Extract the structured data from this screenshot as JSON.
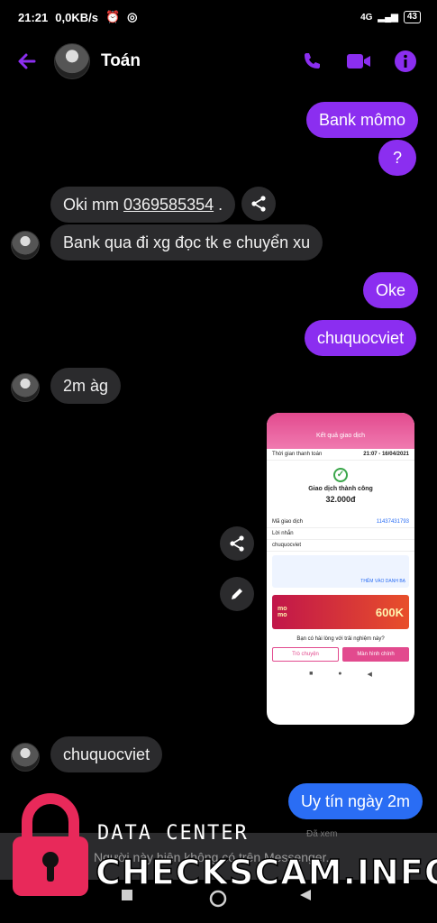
{
  "status_bar": {
    "time": "21:21",
    "speed": "0,0KB/s",
    "signal": "4G",
    "battery": "43"
  },
  "header": {
    "contact_name": "Toán"
  },
  "messages": {
    "m1": "Bank mômo",
    "m2": "?",
    "m3_prefix": "Oki mm ",
    "m3_phone": "0369585354",
    "m3_suffix": " .",
    "m4": "Bank qua đi xg đọc tk e chuyển xu",
    "m5": "Oke",
    "m6": "chuquocviet",
    "m7": "2m àg",
    "m8": "chuquocviet",
    "m9": "Uy tín ngày 2m"
  },
  "receipt": {
    "header": "Kết quả giao dịch",
    "time_label": "Thời gian thanh toán",
    "time_value": "21:07 - 16/04/2021",
    "status": "Giao dịch thành công",
    "amount": "32.000đ",
    "txn_label": "Mã giao dịch",
    "txn_value": "11437431793",
    "note_label": "Lời nhắn",
    "note_value": "chuquocviet",
    "info_link": "THÊM VÀO DANH BẠ",
    "banner": "600K",
    "question": "Bạn có hài lòng với trải nghiệm này?",
    "btn_left": "Trò chuyện",
    "btn_right": "Màn hình chính"
  },
  "footer": {
    "notice": "Người này hiện không có trên Messenger.",
    "seen": "Đã xem"
  },
  "watermark": {
    "top": "DATA CENTER",
    "main": "CHECKSCAM.INFO"
  },
  "colors": {
    "accent": "#8b2ef0",
    "blue": "#2a6df4",
    "bubble_dark": "#2b2b2d",
    "watermark_red": "#e8295a"
  }
}
